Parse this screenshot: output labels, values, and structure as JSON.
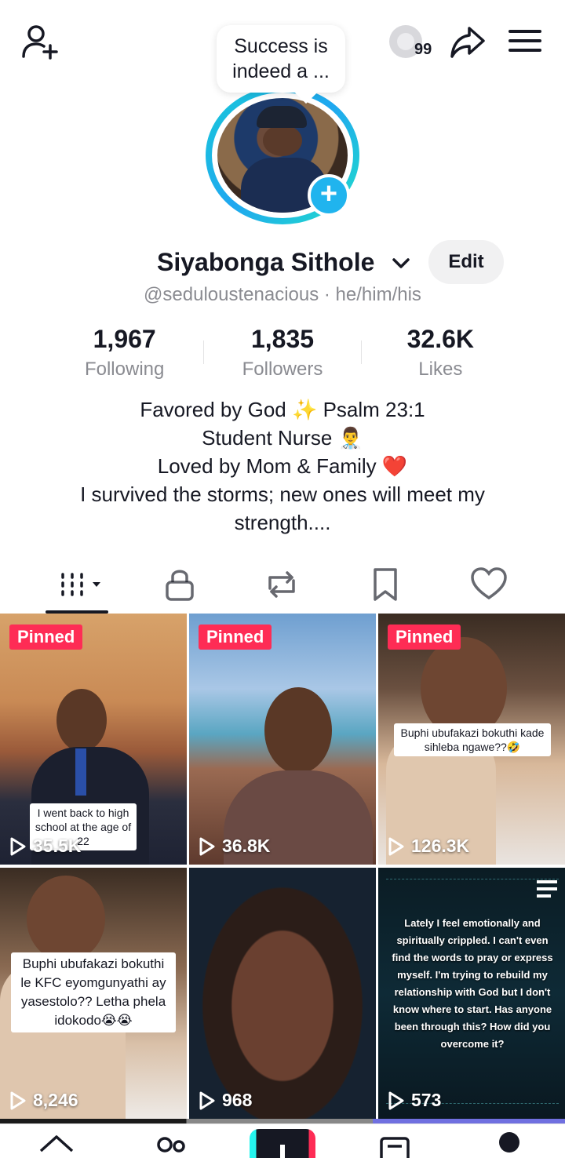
{
  "topbar": {
    "coin_count": "99",
    "icons": [
      "add-user-icon",
      "coin-icon",
      "share-icon",
      "menu-icon"
    ]
  },
  "avatar": {
    "bubble_text": "Success is indeed a ..."
  },
  "profile": {
    "name": "Siyabonga Sithole",
    "edit_label": "Edit",
    "handle": "@seduloustenacious · he/him/his"
  },
  "stats": [
    {
      "value": "1,967",
      "label": "Following"
    },
    {
      "value": "1,835",
      "label": "Followers"
    },
    {
      "value": "32.6K",
      "label": "Likes"
    }
  ],
  "bio": {
    "line1": "Favored by God ✨ Psalm 23:1",
    "line2": "Student Nurse 👨‍⚕️",
    "line3": "Loved by Mom & Family ❤️",
    "line4": "I survived the storms; new ones will meet my strength...."
  },
  "tabs": [
    "videos-tab",
    "private-tab",
    "reposts-tab",
    "favorites-tab",
    "liked-tab"
  ],
  "videos": [
    {
      "pinned": "Pinned",
      "views": "35.5K",
      "caption": "I went back to high school at the age of 22"
    },
    {
      "pinned": "Pinned",
      "views": "36.8K",
      "caption": ""
    },
    {
      "pinned": "Pinned",
      "views": "126.3K",
      "caption": "Buphi ubufakazi bokuthi kade sihleba ngawe??🤣"
    },
    {
      "pinned": "",
      "views": "8,246",
      "caption": "Buphi ubufakazi bokuthi le KFC eyomgunyathi ay yasestolo?? Letha phela idokodo😭😭"
    },
    {
      "pinned": "",
      "views": "968",
      "caption": ""
    },
    {
      "pinned": "",
      "views": "573",
      "caption": "Lately I feel emotionally and spiritually crippled. I can't even find the words to pray or express myself. I'm trying to rebuild my relationship with God but I don't know where to start. Has anyone been through this? How did you overcome it?"
    }
  ],
  "colors": {
    "pinned": "#fe2c55",
    "avatar_ring": "#1fa7f0",
    "text_primary": "#161823",
    "text_secondary": "#8a8b91"
  }
}
